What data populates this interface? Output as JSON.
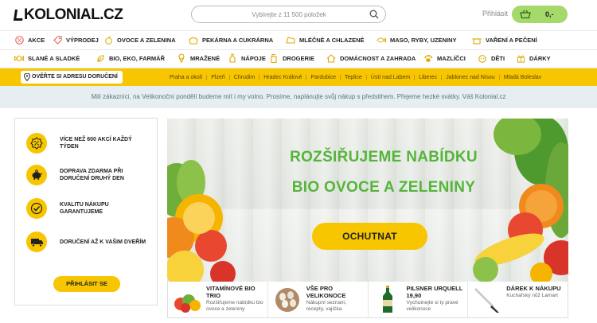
{
  "header": {
    "logo": "KOLONIAL.CZ",
    "search_placeholder": "Vybírejte z 11 500 položek",
    "login_label": "Přihlásit",
    "cart_total": "0,-"
  },
  "categories_row1": [
    {
      "label": "AKCE",
      "icon": "percent-icon"
    },
    {
      "label": "VÝPRODEJ",
      "icon": "tag-icon"
    },
    {
      "label": "OVOCE A ZELENINA",
      "icon": "apple-icon"
    },
    {
      "label": "PEKÁRNA A CUKRÁRNA",
      "icon": "bread-icon"
    },
    {
      "label": "MLÉČNÉ A CHLAZENÉ",
      "icon": "cheese-icon"
    },
    {
      "label": "MASO, RYBY, UZENINY",
      "icon": "fish-icon"
    },
    {
      "label": "VAŘENÍ A PEČENÍ",
      "icon": "pot-icon"
    }
  ],
  "categories_row2": [
    {
      "label": "SLANÉ A SLADKÉ",
      "icon": "candy-icon"
    },
    {
      "label": "BIO, EKO, FARMÁŘ",
      "icon": "leaf-icon"
    },
    {
      "label": "MRAŽENÉ",
      "icon": "icecream-icon"
    },
    {
      "label": "NÁPOJE",
      "icon": "bottle-icon"
    },
    {
      "label": "DROGERIE",
      "icon": "spray-icon"
    },
    {
      "label": "DOMÁCNOST A ZAHRADA",
      "icon": "house-icon"
    },
    {
      "label": "MAZLÍČCI",
      "icon": "paw-icon"
    },
    {
      "label": "DĚTI",
      "icon": "baby-icon"
    },
    {
      "label": "DÁRKY",
      "icon": "gift-icon"
    }
  ],
  "delivery": {
    "address_button": "OVĚŘTE SI ADRESU DORUČENÍ",
    "cities": [
      "Praha a okolí",
      "Plzeň",
      "Chrudim",
      "Hradec Králové",
      "Pardubice",
      "Teplice",
      "Ústí nad Labem",
      "Liberec",
      "Jablonec nad Nisou",
      "Mladá Boleslav"
    ]
  },
  "notice": "Milí zákazníci, na Velikonoční pondělí budeme mít i my volno. Prosíme, naplánujte svůj nákup s předstihem. Přejeme hezké svátky. Váš Kolonial.cz",
  "benefits": {
    "items": [
      {
        "text": "Více než 600 akcí každý týden",
        "icon": "percent-badge-icon"
      },
      {
        "text": "Doprava zdarma při doručení druhý den",
        "icon": "piggy-bank-icon"
      },
      {
        "text": "Kvalitu nákupu garantujeme",
        "icon": "checkmark-icon"
      },
      {
        "text": "Doručení až k vašim dveřím",
        "icon": "truck-icon"
      }
    ],
    "login_button": "PŘIHLÁSIT SE"
  },
  "banner": {
    "title_line1": "ROZŠIŘUJEME NABÍDKU",
    "title_line2": "BIO OVOCE A ZELENINY",
    "cta": "OCHUTNAT"
  },
  "promos": [
    {
      "title": "VITAMÍNOVÉ BIO TRIO",
      "desc": "Rozšiřujeme nabídku bio ovoce a zeleniny"
    },
    {
      "title": "VŠE PRO VELIKONOCE",
      "desc": "Nákupní seznam, recepty, vajíčka"
    },
    {
      "title": "PILSNER URQUELL 19,90",
      "desc": "Vychutnejte si ty pravé velikonoce"
    },
    {
      "title": "DÁREK K NÁKUPU",
      "desc": "Kuchařský nůž Lamart"
    }
  ],
  "colors": {
    "yellow": "#f7c600",
    "green_cart": "#a5d96a",
    "banner_green": "#55b53a",
    "notice_bg": "#e6eef1",
    "icon_red": "#e2584b"
  }
}
